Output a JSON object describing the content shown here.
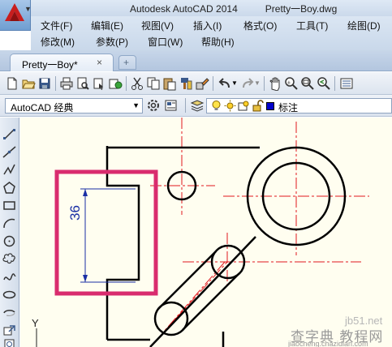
{
  "window": {
    "app_title": "Autodesk AutoCAD 2014",
    "file_title": "Pretty一Boy.dwg"
  },
  "menu": {
    "row1": [
      "文件(F)",
      "编辑(E)",
      "视图(V)",
      "插入(I)",
      "格式(O)",
      "工具(T)",
      "绘图(D)"
    ],
    "row2": [
      "修改(M)",
      "参数(P)",
      "窗口(W)",
      "帮助(H)"
    ]
  },
  "tabs": {
    "document_tab": "Pretty一Boy*",
    "close_glyph": "×",
    "new_tab_glyph": "+"
  },
  "workspace": {
    "selected": "AutoCAD 经典",
    "dropdown_glyph": "▼"
  },
  "layer": {
    "name": "标注",
    "color": "#0000cc"
  },
  "drawing": {
    "dimension_value": "36",
    "ucs_axis_label": "Y",
    "highlight_color": "#d92c6e",
    "centerline_color": "#e0181e",
    "dimension_color": "#1a2fa5"
  },
  "watermark": {
    "line1": "jb51.net",
    "line2": "查字典 教程网",
    "line3": "jiaocheng.chazidian.com"
  },
  "icons": {
    "app_menu": "autocad-logo-icon",
    "toolbar": [
      "new-icon",
      "open-icon",
      "save-icon",
      "print-icon",
      "print-preview-icon",
      "publish-icon",
      "3d-print-icon",
      "cut-icon",
      "copy-icon",
      "paste-icon",
      "match-properties-icon",
      "block-editor-icon",
      "undo-icon",
      "redo-icon",
      "pan-icon",
      "zoom-realtime-icon",
      "zoom-window-icon",
      "zoom-previous-icon",
      "properties-icon"
    ],
    "palette": [
      "line-icon",
      "construction-line-icon",
      "polyline-icon",
      "polygon-icon",
      "rectangle-icon",
      "arc-icon",
      "circle-icon",
      "revision-cloud-icon",
      "spline-icon",
      "ellipse-icon",
      "ellipse-arc-icon",
      "insert-block-icon",
      "make-block-icon"
    ]
  }
}
